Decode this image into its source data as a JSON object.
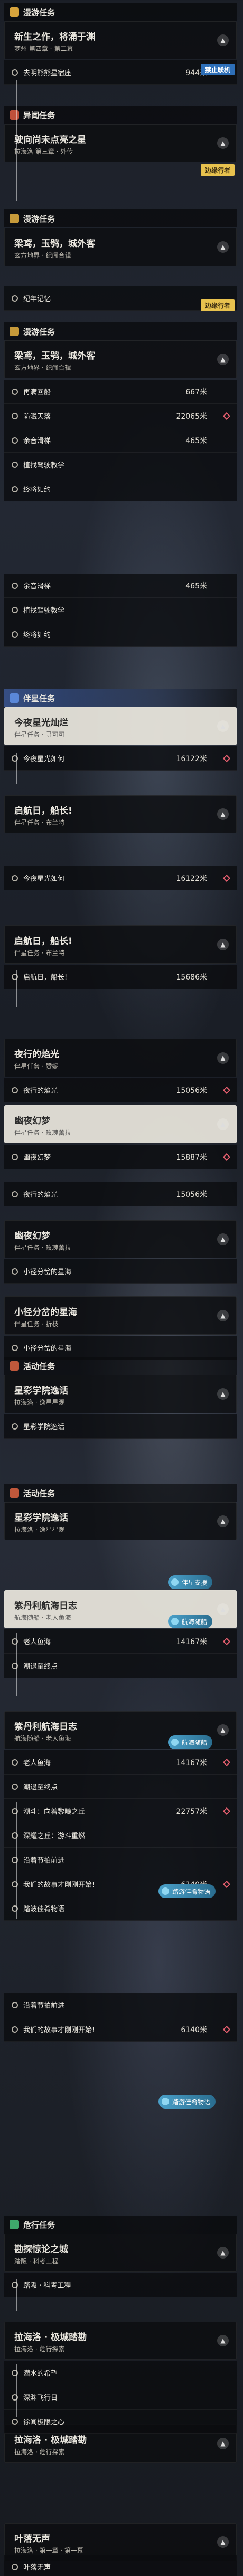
{
  "categories": {
    "main": "漫游任务",
    "side": "异闻任务",
    "daily": "漫游任务",
    "companion": "伴星任务",
    "event": "活动任务",
    "adventure": "危行任务"
  },
  "labels": {
    "team_tag": "禁止联机",
    "journey_tag": "边缘行者",
    "journey_tag2": "边缘行者",
    "companion_badge": "伴星支援",
    "companion_badge2": "航海随船",
    "companion_badge3": "航海随船",
    "adventure_badge": "踏游佳肴物语",
    "adventure_badge2": "踏游佳肴物语"
  },
  "cards": [
    {
      "title": "新生之作，将涌于渊",
      "sub": "梦州 第四章 · 第二幕"
    },
    {
      "title": "驶向尚未点亮之星",
      "sub": "拉海洛 第三章 · 外传"
    },
    {
      "title": "梁鸢，玉鸮，城外客",
      "sub": "玄方地界 · 纪闻合辑"
    },
    {
      "title": "梁鸢，玉鸮，城外客",
      "sub": "玄方地界 · 纪闻合辑"
    },
    {
      "title": "今夜星光灿烂",
      "sub": "伴星任务 · 寻可可"
    },
    {
      "title": "启航日，船长!",
      "sub": "伴星任务 · 布兰特"
    },
    {
      "title": "启航日，船长!",
      "sub": "伴星任务 · 布兰特"
    },
    {
      "title": "夜行的焰光",
      "sub": "伴星任务 · 赞妮"
    },
    {
      "title": "幽夜幻梦",
      "sub": "伴星任务 · 玫瑰蕾拉"
    },
    {
      "title": "幽夜幻梦",
      "sub": "伴星任务 · 玫瑰蕾拉"
    },
    {
      "title": "小径分岔的星海",
      "sub": "伴星任务 · 折枝"
    },
    {
      "title": "星彩学院逸话",
      "sub": "拉海洛 · 逸星星观"
    },
    {
      "title": "星彩学院逸话",
      "sub": "拉海洛 · 逸星星观"
    },
    {
      "title": "紫丹利航海日志",
      "sub": "航海随船 · 老人鱼海"
    },
    {
      "title": "紫丹利航海日志",
      "sub": "航海随船 · 老人鱼海"
    },
    {
      "title": "勘探惊论之城",
      "sub": "踏阪 · 科考工程"
    },
    {
      "title": "拉海洛 · 极城踏勘",
      "sub": "拉海洛 · 危行探索"
    },
    {
      "title": "拉海洛 · 极城踏勘",
      "sub": "拉海洛 · 危行探索"
    },
    {
      "title": "叶落无声",
      "sub": "拉海洛 · 第一章 · 第一幕"
    }
  ],
  "rows": [
    {
      "label": "去明熊熊星宿座",
      "dist": "944米"
    },
    {
      "label": "纪年记忆",
      "dist": ""
    },
    {
      "label": "再满回船",
      "dist": "667米"
    },
    {
      "label": "防溅天落",
      "dist": "22065米"
    },
    {
      "label": "余音滑梯",
      "dist": "465米"
    },
    {
      "label": "植找驾驶教学",
      "dist": ""
    },
    {
      "label": "终将如约",
      "dist": ""
    },
    {
      "label": "余音滑梯",
      "dist": "465米"
    },
    {
      "label": "植找驾驶教学",
      "dist": ""
    },
    {
      "label": "终将如约",
      "dist": ""
    },
    {
      "label": "今夜星光如何",
      "dist": "16122米"
    },
    {
      "label": "今夜星光如何",
      "dist": "16122米"
    },
    {
      "label": "启航日，船长!",
      "dist": "15686米"
    },
    {
      "label": "夜行的焰光",
      "dist": "15056米"
    },
    {
      "label": "夜行的焰光",
      "dist": "15056米"
    },
    {
      "label": "幽夜幻梦",
      "dist": "15887米"
    },
    {
      "label": "小径分岔的星海",
      "dist": ""
    },
    {
      "label": "小径分岔的星海",
      "dist": ""
    },
    {
      "label": "星彩学院逸话",
      "dist": ""
    },
    {
      "label": "老人鱼海",
      "dist": "14167米"
    },
    {
      "label": "潮退至终点",
      "dist": ""
    },
    {
      "label": "老人鱼海",
      "dist": "14167米"
    },
    {
      "label": "潮退至终点",
      "dist": ""
    },
    {
      "label": "潮斗：向着黎曦之丘",
      "dist": "22757米"
    },
    {
      "label": "深耀之丘：游斗重燃",
      "dist": ""
    },
    {
      "label": "沿着节拍前进",
      "dist": ""
    },
    {
      "label": "我们的故事才刚刚开始!",
      "dist": "6140米"
    },
    {
      "label": "踏波佳肴物语",
      "dist": ""
    },
    {
      "label": "沿着节拍前进",
      "dist": ""
    },
    {
      "label": "我们的故事才刚刚开始!",
      "dist": "6140米"
    },
    {
      "label": "踏阪 · 科考工程",
      "dist": ""
    },
    {
      "label": "潜水的希望",
      "dist": ""
    },
    {
      "label": "深渊飞行日",
      "dist": ""
    },
    {
      "label": "徐闻极限之心",
      "dist": ""
    },
    {
      "label": "叶落无声",
      "dist": ""
    }
  ]
}
